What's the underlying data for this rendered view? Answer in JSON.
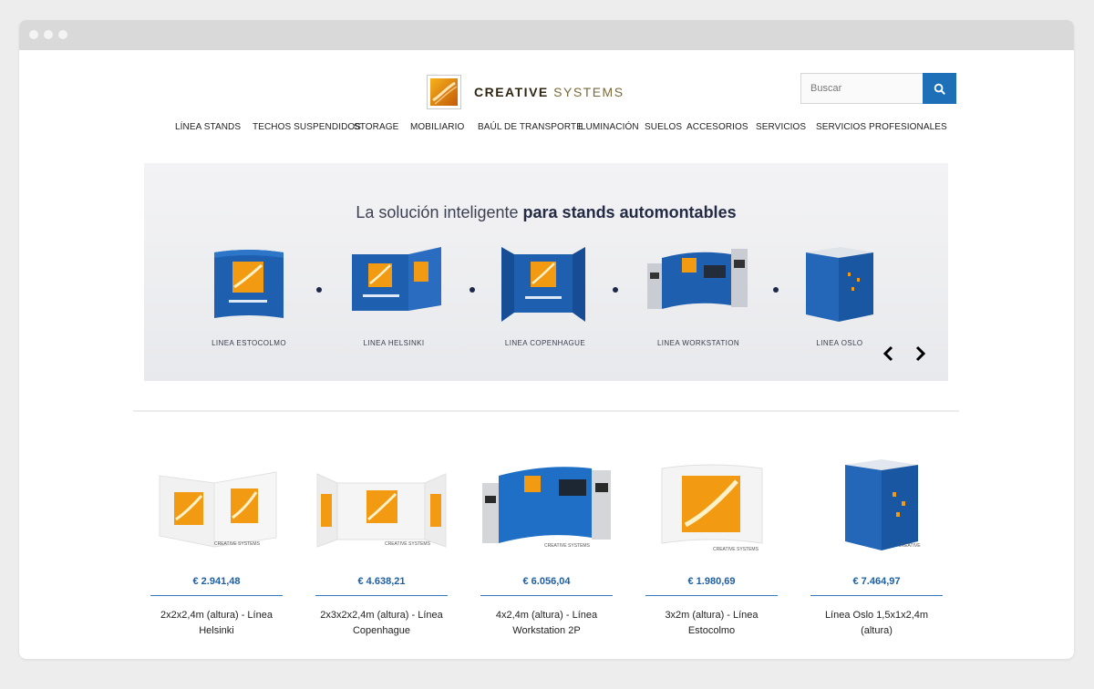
{
  "brand": {
    "name_bold": "CREATIVE",
    "name_light": "SYSTEMS",
    "mark_colors": [
      "#f2a516",
      "#c8620b"
    ]
  },
  "search": {
    "placeholder": "Buscar",
    "button_icon": "search-icon"
  },
  "nav": [
    "LÍNEA STANDS",
    "TECHOS SUSPENDIDOS",
    "STORAGE",
    "MOBILIARIO",
    "BAÚL DE TRANSPORTE",
    "ILUMINACIÓN",
    "SUELOS",
    "ACCESORIOS",
    "SERVICIOS",
    "SERVICIOS PROFESIONALES"
  ],
  "slider": {
    "title_light": "La solución inteligente ",
    "title_bold": "para stands automontables",
    "products": [
      "LINEA ESTOCOLMO",
      "LINEA HELSINKI",
      "LINEA COPENHAGUE",
      "LINEA WORKSTATION",
      "LINEA OSLO"
    ],
    "prev_icon": "chevron-left-icon",
    "next_icon": "chevron-right-icon"
  },
  "products": [
    {
      "price": "€ 2.941,48",
      "name": "2x2x2,4m (altura) - Línea Helsinki"
    },
    {
      "price": "€ 4.638,21",
      "name": "2x3x2x2,4m (altura) - Línea Copenhague"
    },
    {
      "price": "€ 6.056,04",
      "name": "4x2,4m (altura) - Línea Workstation 2P"
    },
    {
      "price": "€ 1.980,69",
      "name": "3x2m (altura) - Línea Estocolmo"
    },
    {
      "price": "€ 7.464,97",
      "name": "Línea Oslo 1,5x1x2,4m (altura)"
    }
  ],
  "colors": {
    "accent": "#1d6fb8",
    "price": "#1d5fa6",
    "stand_blue": "#1f5fb0",
    "stand_orange": "#f29a12"
  }
}
